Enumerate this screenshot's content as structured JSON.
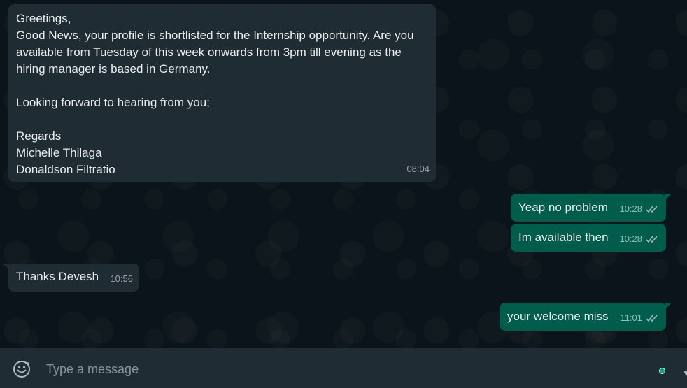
{
  "messages": [
    {
      "direction": "incoming",
      "text": "Greetings,\nGood News, your profile is shortlisted for the Internship opportunity. Are you available from Tuesday of this week onwards from 3pm till evening as the hiring manager is based in Germany.\n\nLooking forward to hearing from you;\n\nRegards\nMichelle Thilaga\nDonaldson Filtratio",
      "time": "08:04"
    },
    {
      "direction": "outgoing",
      "text": "Yeap no problem",
      "time": "10:28",
      "status": "read"
    },
    {
      "direction": "outgoing",
      "text": "Im available then",
      "time": "10:28",
      "status": "read"
    },
    {
      "direction": "incoming",
      "text": "Thanks Devesh",
      "time": "10:56"
    },
    {
      "direction": "outgoing",
      "text": "your welcome miss",
      "time": "11:01",
      "status": "read"
    }
  ],
  "composer": {
    "placeholder": "Type a message",
    "emoji_icon": "emoji-icon"
  },
  "colors": {
    "background": "#0b141a",
    "incoming_bubble": "#202c33",
    "outgoing_bubble": "#005c4b",
    "composer": "#1f2c33",
    "tick_read": "#53bdeb",
    "accent": "#00a884"
  }
}
